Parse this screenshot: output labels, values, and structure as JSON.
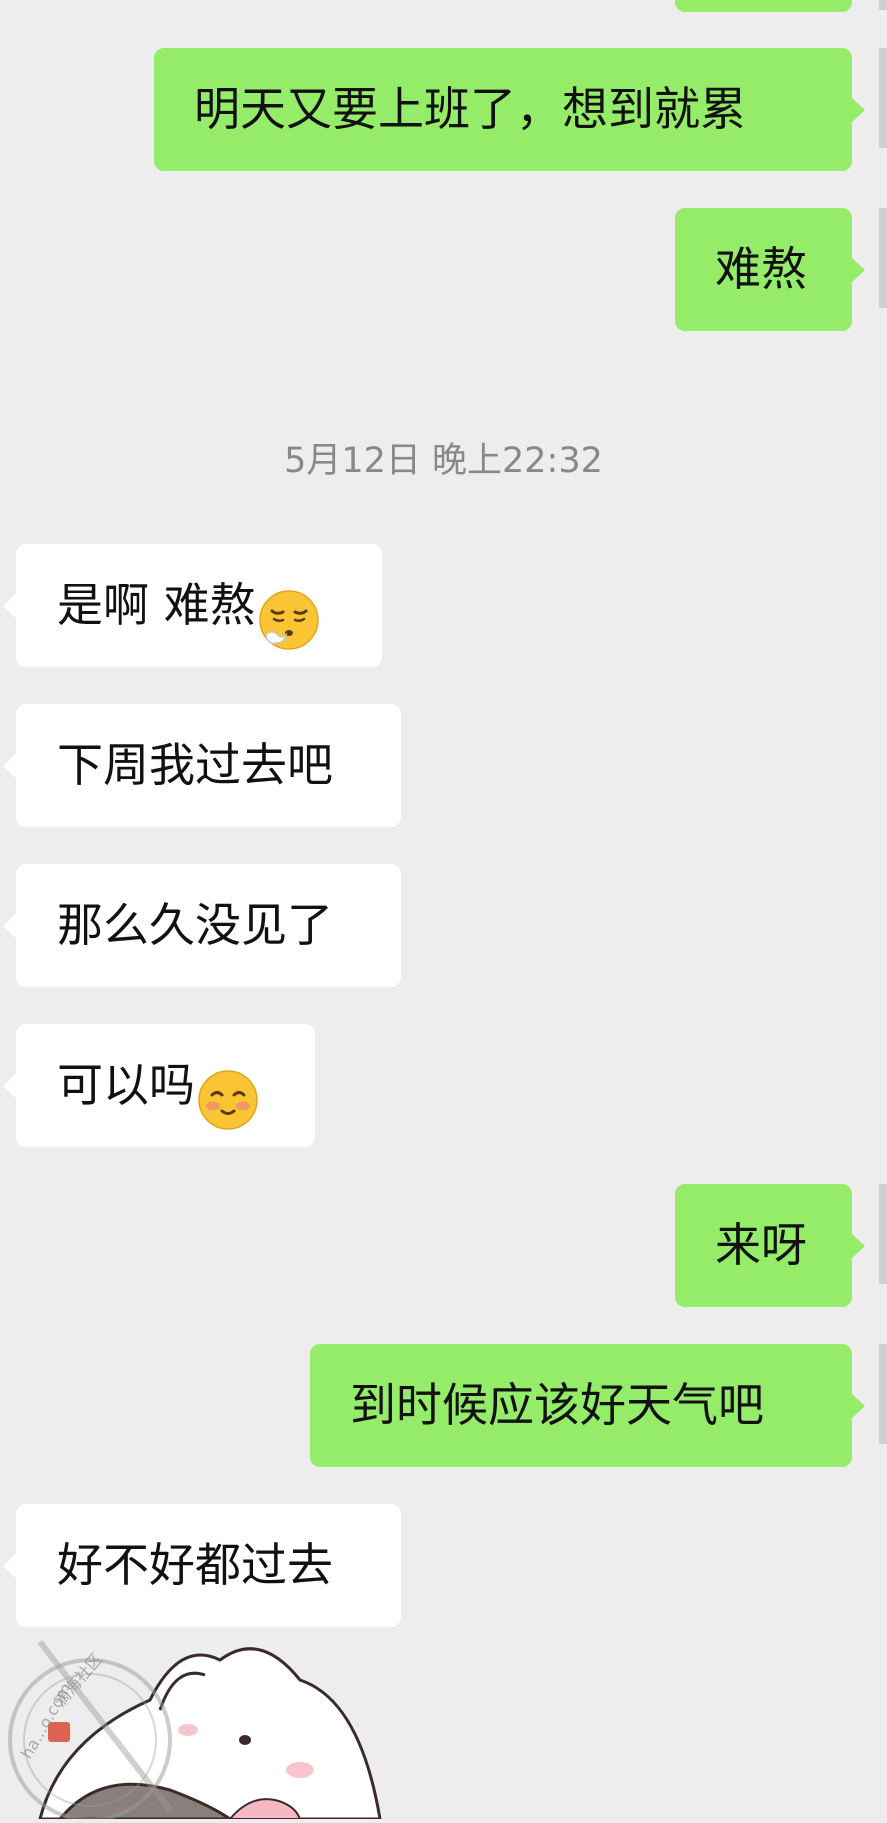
{
  "colors": {
    "background": "#ededed",
    "outgoing_bubble": "#95ec69",
    "incoming_bubble": "#ffffff",
    "timestamp_text": "#888888"
  },
  "timestamp": "5月12日 晚上22:32",
  "messages": {
    "m0": {
      "direction": "outgoing",
      "text": ""
    },
    "m1": {
      "direction": "outgoing",
      "text": "明天又要上班了，想到就累"
    },
    "m2": {
      "direction": "outgoing",
      "text": "难熬"
    },
    "m3": {
      "direction": "incoming",
      "text": "是啊 难熬",
      "emoji": "face-exhaling-emoji"
    },
    "m4": {
      "direction": "incoming",
      "text": "下周我过去吧"
    },
    "m5": {
      "direction": "incoming",
      "text": "那么久没见了"
    },
    "m6": {
      "direction": "incoming",
      "text": "可以吗",
      "emoji": "smiling-blush-emoji"
    },
    "m7": {
      "direction": "outgoing",
      "text": "来呀"
    },
    "m8": {
      "direction": "outgoing",
      "text": "到时候应该好天气吧"
    },
    "m9": {
      "direction": "incoming",
      "text": "好不好都过去"
    }
  },
  "sticker": {
    "icon": "cartoon-sticker"
  },
  "watermark": {
    "text": "滴海社区",
    "domain": "ha...o.com",
    "icon": "watermark-logo"
  }
}
